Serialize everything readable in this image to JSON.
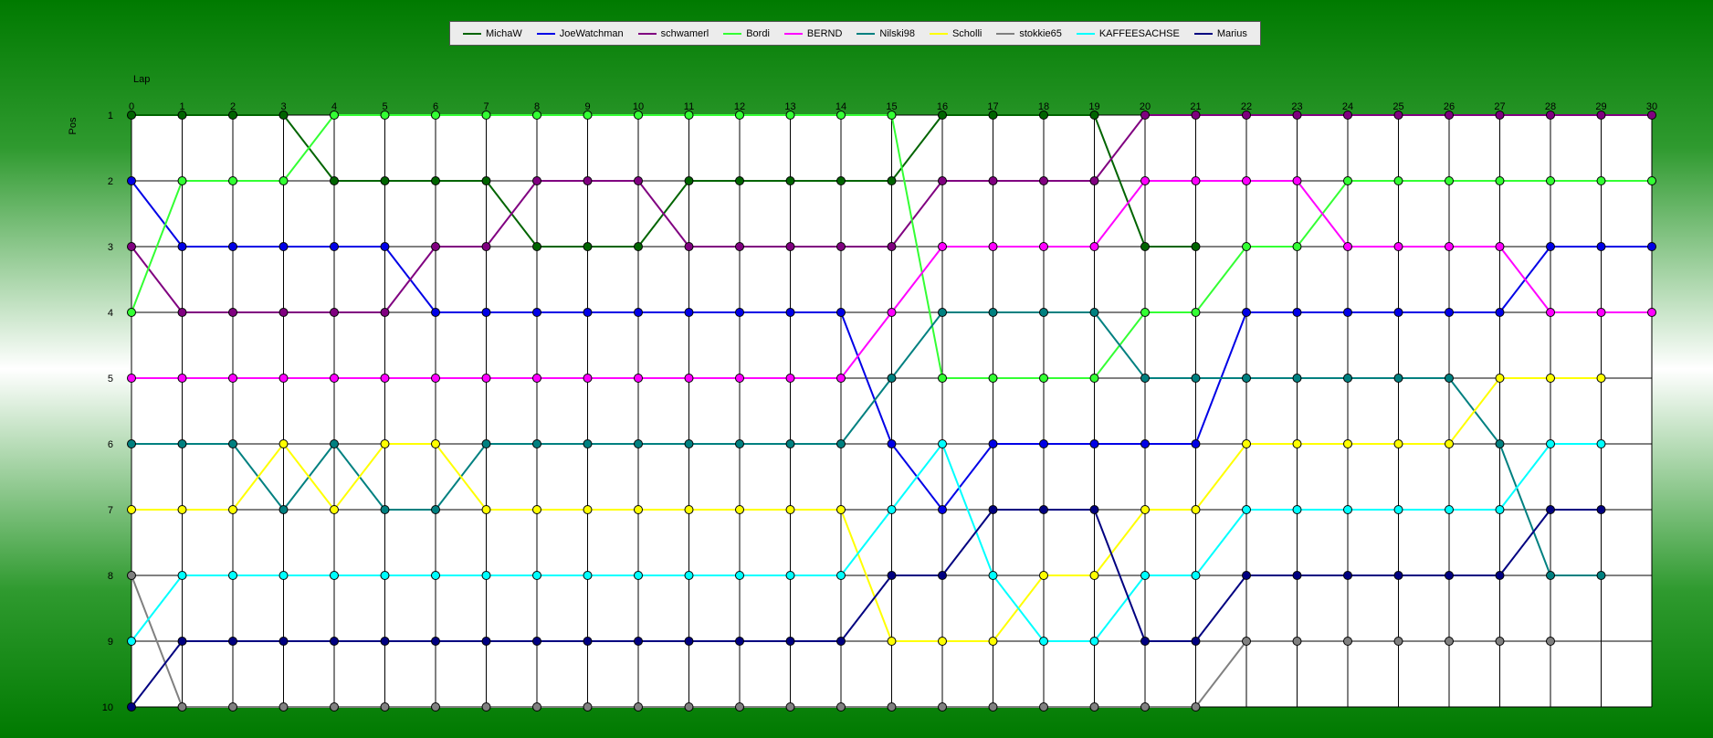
{
  "chart_data": {
    "type": "line",
    "xlabel": "Lap",
    "ylabel": "Pos",
    "x": [
      0,
      1,
      2,
      3,
      4,
      5,
      6,
      7,
      8,
      9,
      10,
      11,
      12,
      13,
      14,
      15,
      16,
      17,
      18,
      19,
      20,
      21,
      22,
      23,
      24,
      25,
      26,
      27,
      28,
      29,
      30
    ],
    "positions": [
      1,
      2,
      3,
      4,
      5,
      6,
      7,
      8,
      9,
      10
    ],
    "xlim": [
      0,
      30
    ],
    "ylim": [
      1,
      10
    ],
    "y_inverted": true,
    "grid": true,
    "legend_position": "top-center",
    "series": [
      {
        "name": "MichaW",
        "color": "#006400",
        "values": [
          1,
          1,
          1,
          1,
          2,
          2,
          2,
          2,
          3,
          3,
          3,
          2,
          2,
          2,
          2,
          2,
          1,
          1,
          1,
          1,
          3,
          3
        ]
      },
      {
        "name": "JoeWatchman",
        "color": "#0000e6",
        "values": [
          2,
          3,
          3,
          3,
          3,
          3,
          4,
          4,
          4,
          4,
          4,
          4,
          4,
          4,
          4,
          6,
          7,
          6,
          6,
          6,
          6,
          6,
          4,
          4,
          4,
          4,
          4,
          4,
          3,
          3,
          3
        ]
      },
      {
        "name": "schwamerl",
        "color": "#800080",
        "values": [
          3,
          4,
          4,
          4,
          4,
          4,
          3,
          3,
          2,
          2,
          2,
          3,
          3,
          3,
          3,
          3,
          2,
          2,
          2,
          2,
          1,
          1,
          1,
          1,
          1,
          1,
          1,
          1,
          1,
          1,
          1
        ]
      },
      {
        "name": "Bordi",
        "color": "#33ff33",
        "values": [
          4,
          2,
          2,
          2,
          1,
          1,
          1,
          1,
          1,
          1,
          1,
          1,
          1,
          1,
          1,
          1,
          5,
          5,
          5,
          5,
          4,
          4,
          3,
          3,
          2,
          2,
          2,
          2,
          2,
          2,
          2
        ]
      },
      {
        "name": "BERND",
        "color": "#ff00ff",
        "values": [
          5,
          5,
          5,
          5,
          5,
          5,
          5,
          5,
          5,
          5,
          5,
          5,
          5,
          5,
          5,
          4,
          3,
          3,
          3,
          3,
          2,
          2,
          2,
          2,
          3,
          3,
          3,
          3,
          4,
          4,
          4
        ]
      },
      {
        "name": "Nilski98",
        "color": "#008080",
        "values": [
          6,
          6,
          6,
          7,
          6,
          7,
          7,
          6,
          6,
          6,
          6,
          6,
          6,
          6,
          6,
          5,
          4,
          4,
          4,
          4,
          5,
          5,
          5,
          5,
          5,
          5,
          5,
          6,
          8,
          8
        ]
      },
      {
        "name": "Scholli",
        "color": "#ffff00",
        "values": [
          7,
          7,
          7,
          6,
          7,
          6,
          6,
          7,
          7,
          7,
          7,
          7,
          7,
          7,
          7,
          9,
          9,
          9,
          8,
          8,
          7,
          7,
          6,
          6,
          6,
          6,
          6,
          5,
          5,
          5
        ]
      },
      {
        "name": "stokkie65",
        "color": "#808080",
        "values": [
          8,
          10,
          10,
          10,
          10,
          10,
          10,
          10,
          10,
          10,
          10,
          10,
          10,
          10,
          10,
          10,
          10,
          10,
          10,
          10,
          10,
          10,
          9,
          9,
          9,
          9,
          9,
          9,
          9
        ]
      },
      {
        "name": "KAFFEESACHSE",
        "color": "#00ffff",
        "values": [
          9,
          8,
          8,
          8,
          8,
          8,
          8,
          8,
          8,
          8,
          8,
          8,
          8,
          8,
          8,
          7,
          6,
          8,
          9,
          9,
          8,
          8,
          7,
          7,
          7,
          7,
          7,
          7,
          6,
          6
        ]
      },
      {
        "name": "Marius",
        "color": "#000080",
        "values": [
          10,
          9,
          9,
          9,
          9,
          9,
          9,
          9,
          9,
          9,
          9,
          9,
          9,
          9,
          9,
          8,
          8,
          7,
          7,
          7,
          9,
          9,
          8,
          8,
          8,
          8,
          8,
          8,
          7,
          7
        ]
      }
    ]
  }
}
